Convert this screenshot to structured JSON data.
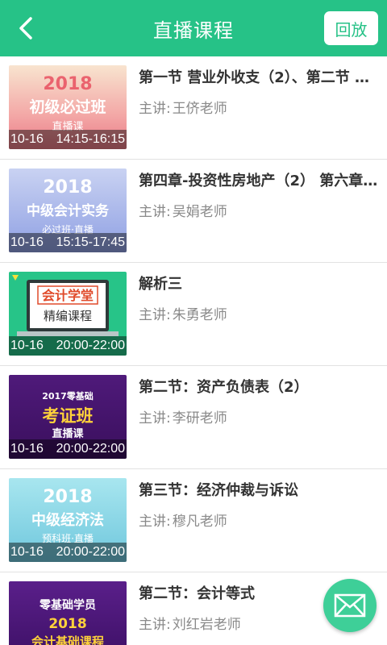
{
  "header": {
    "title": "直播课程",
    "replay_label": "回放"
  },
  "courses": [
    {
      "title": "第一节 营业外收支（2）、第二节 …",
      "teacher_prefix": "主讲:",
      "teacher": "王侪老师",
      "date": "10-16",
      "time": "14:15-16:15",
      "art": {
        "year": "2018",
        "line1": "初级必过班",
        "line2": "直播课"
      }
    },
    {
      "title": "第四章-投资性房地产（2） 第六章…",
      "teacher_prefix": "主讲:",
      "teacher": "吴娟老师",
      "date": "10-16",
      "time": "15:15-17:45",
      "art": {
        "year": "2018",
        "line1": "中级会计实务",
        "line2": "必过班·直播"
      }
    },
    {
      "title": "解析三",
      "teacher_prefix": "主讲:",
      "teacher": "朱勇老师",
      "date": "10-16",
      "time": "20:00-22:00",
      "art": {
        "line1": "会计学堂",
        "line2": "精编课程"
      }
    },
    {
      "title": "第二节：资产负债表（2）",
      "teacher_prefix": "主讲:",
      "teacher": "李研老师",
      "date": "10-16",
      "time": "20:00-22:00",
      "art": {
        "year": "2017零基础",
        "line1": "考证班",
        "line2": "直播课"
      }
    },
    {
      "title": "第三节：经济仲裁与诉讼",
      "teacher_prefix": "主讲:",
      "teacher": "穆凡老师",
      "date": "10-16",
      "time": "20:00-22:00",
      "art": {
        "year": "2018",
        "line1": "中级经济法",
        "line2": "预科班·直播"
      }
    },
    {
      "title": "第二节：会计等式",
      "teacher_prefix": "主讲:",
      "teacher": "刘红岩老师",
      "date": "",
      "time": "",
      "art": {
        "year": "零基础学员",
        "line1": "2018",
        "line2": "会计基础课程"
      }
    }
  ],
  "icons": {
    "back": "chevron-left-icon",
    "fab": "mail-icon"
  },
  "colors": {
    "primary": "#26c287",
    "fab": "#3ecf98"
  }
}
